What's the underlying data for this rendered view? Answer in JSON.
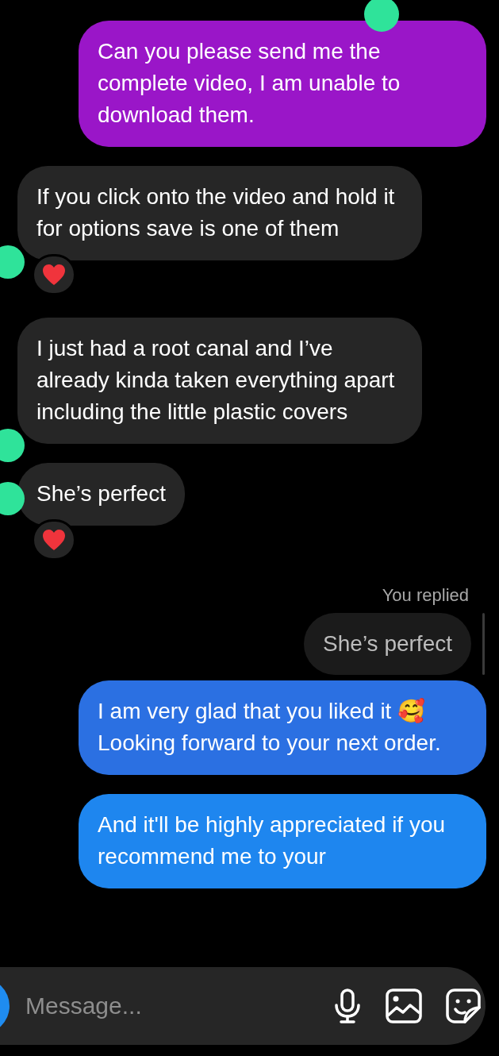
{
  "messages": [
    {
      "kind": "sent",
      "color": "#9a16c8",
      "text": "Can you please send me the complete video, I am unable to download them."
    },
    {
      "kind": "received",
      "text": "If you click onto the video and hold it for options save is one of them",
      "reacted": true
    },
    {
      "kind": "received",
      "text": "I just had a root canal and I’ve already kinda taken everything apart including the little plastic covers",
      "reacted": false
    },
    {
      "kind": "received",
      "text": "She’s perfect",
      "reacted": true
    },
    {
      "kind": "reply_label",
      "text": "You replied"
    },
    {
      "kind": "reply_quote",
      "text": "She’s perfect"
    },
    {
      "kind": "sent",
      "color": "#2b70e2",
      "text": "I am very glad that you liked it 🥰 Looking forward to your next order."
    },
    {
      "kind": "sent",
      "color": "#1e86ef",
      "text": "And it'll be highly appreciated if you recommend me to your"
    }
  ],
  "composer": {
    "placeholder": "Message..."
  }
}
